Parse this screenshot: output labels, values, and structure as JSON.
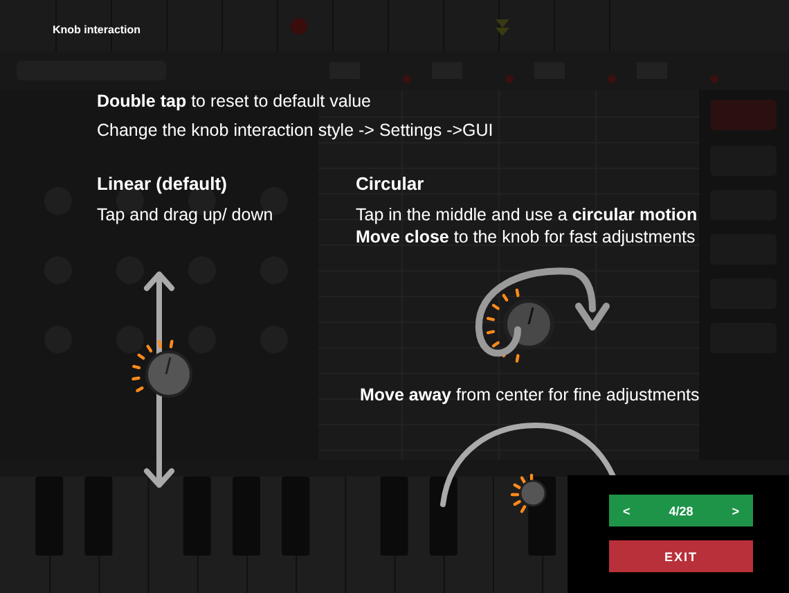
{
  "tutorial": {
    "title": "Knob interaction",
    "intro": [
      "**Double tap** to reset to default value",
      "Change the knob interaction style -> Settings ->GUI"
    ],
    "linear": {
      "heading": "Linear (default)",
      "text": "Tap and drag up/ down"
    },
    "circular": {
      "heading": "Circular",
      "lines": [
        "Tap in the middle and use a **circular motion**",
        "**Move close** to the knob for fast adjustments"
      ]
    },
    "fine": "**Move away** from center for fine adjustments",
    "pager": {
      "prev": "<",
      "page": "4/28",
      "next": ">"
    },
    "exit": "EXIT"
  }
}
